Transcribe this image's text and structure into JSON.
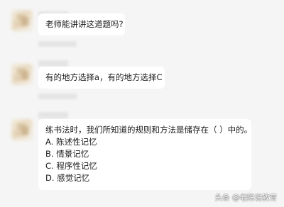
{
  "messages": [
    {
      "text": "老师能讲讲这道题吗?"
    },
    {
      "text": "有的地方选择a，有的地方选择C"
    },
    {
      "question": "练书法时，我们所知道的规则和方法是储存在（    ）中的。",
      "options": [
        "A. 陈述性记忆",
        "B. 情景记忆",
        "C. 程序性记忆",
        "D. 感觉记忆"
      ]
    }
  ],
  "watermark": "头条 @老陈说教育"
}
